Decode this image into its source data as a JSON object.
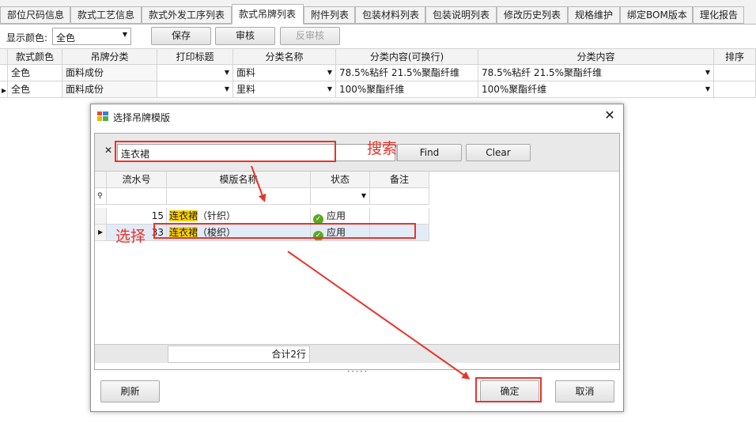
{
  "tabs": [
    {
      "label": "部位尺码信息"
    },
    {
      "label": "款式工艺信息"
    },
    {
      "label": "款式外发工序列表"
    },
    {
      "label": "款式吊牌列表",
      "active": true
    },
    {
      "label": "附件列表"
    },
    {
      "label": "包装材料列表"
    },
    {
      "label": "包装说明列表"
    },
    {
      "label": "修改历史列表"
    },
    {
      "label": "规格维护"
    },
    {
      "label": "绑定BOM版本"
    },
    {
      "label": "理化报告"
    }
  ],
  "toolbar": {
    "color_label": "显示颜色:",
    "color_value": "全色",
    "save": "保存",
    "review": "审核",
    "unreview": "反审核"
  },
  "grid": {
    "columns": [
      "款式颜色",
      "吊牌分类",
      "打印标题",
      "分类名称",
      "分类内容(可换行)",
      "分类内容",
      "排序"
    ],
    "rows": [
      [
        "全色",
        "面料成份",
        "",
        "面料",
        "78.5%粘纤  21.5%聚酯纤维",
        "78.5%粘纤  21.5%聚酯纤维",
        ""
      ],
      [
        "全色",
        "面料成份",
        "",
        "里料",
        "100%聚酯纤维",
        "100%聚酯纤维",
        ""
      ]
    ]
  },
  "dialog": {
    "title": "选择吊牌模版",
    "search_value": "连衣裙",
    "find": "Find",
    "clear": "Clear",
    "columns": [
      "流水号",
      "模版名称",
      "状态",
      "备注"
    ],
    "rows": [
      {
        "id": "15",
        "name_hl": "连衣裙",
        "name_rest": "（针织）",
        "status": "应用",
        "note": ""
      },
      {
        "id": "33",
        "name_hl": "连衣裙",
        "name_rest": "（梭织）",
        "status": "应用",
        "note": ""
      }
    ],
    "total": "合计2行",
    "refresh": "刷新",
    "confirm": "确定",
    "cancel": "取消"
  },
  "annotations": {
    "search": "搜索",
    "select": "选择",
    "color": "#e8332a"
  }
}
